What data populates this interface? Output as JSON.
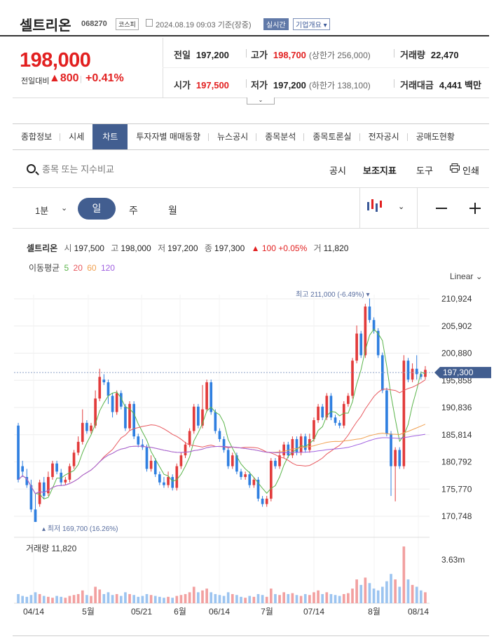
{
  "header": {
    "name": "셀트리온",
    "code": "068270",
    "market": "코스피",
    "date": "2024.08.19 09:03 기준(장중)",
    "realtime": "실시간",
    "company_info": "기업개요 ▾"
  },
  "quote": {
    "price": "198,000",
    "diff_label": "전일대비",
    "diff_value": "▲800",
    "diff_pct": "+0.41%",
    "prev_label": "전일",
    "prev": "197,200",
    "high_label": "고가",
    "high": "198,700",
    "upper_limit": "(상한가 256,000)",
    "volume_label": "거래량",
    "volume": "22,470",
    "open_label": "시가",
    "open": "197,500",
    "low_label": "저가",
    "low": "197,200",
    "lower_limit": "(하한가 138,100)",
    "amount_label": "거래대금",
    "amount": "4,441 백만"
  },
  "tabs": [
    "종합정보",
    "시세",
    "차트",
    "투자자별 매매동향",
    "뉴스공시",
    "종목분석",
    "종목토론실",
    "전자공시",
    "공매도현황"
  ],
  "search": {
    "placeholder": "종목 또는 지수비교",
    "tools": [
      "공시",
      "보조지표",
      "도구",
      "인쇄"
    ]
  },
  "period": {
    "interval": "1분",
    "day": "일",
    "week": "주",
    "month": "월"
  },
  "chart_info": {
    "name": "셀트리온",
    "open_k": "시",
    "open": "197,500",
    "high_k": "고",
    "high": "198,000",
    "low_k": "저",
    "low": "197,200",
    "close_k": "종",
    "close": "197,300",
    "change": "▲ 100 +0.05%",
    "vol_k": "거",
    "vol": "11,820",
    "ma_label": "이동평균",
    "ma": [
      {
        "period": "5",
        "color": "#5ab44a"
      },
      {
        "period": "20",
        "color": "#e8585e"
      },
      {
        "period": "60",
        "color": "#f0a050"
      },
      {
        "period": "120",
        "color": "#a060e0"
      }
    ],
    "scale": "Linear"
  },
  "chart_data": {
    "type": "candlestick",
    "y_ticks": [
      "210,924",
      "205,902",
      "200,880",
      "195,858",
      "190,836",
      "185,814",
      "180,792",
      "175,770",
      "170,748"
    ],
    "y_range": [
      168500,
      213500
    ],
    "x_ticks": [
      "04/14",
      "5월",
      "05/21",
      "6월",
      "06/14",
      "7월",
      "07/14",
      "8월",
      "08/14"
    ],
    "current_price": "197,300",
    "current_value": 197300,
    "max_label": "최고 211,000 (-6.49%)",
    "max_value": 211000,
    "min_label": "최저 169,700 (16.26%)",
    "min_value": 169700,
    "volume_label": "거래량 11,820",
    "volume_scale": "3.63m",
    "candles": [
      [
        187500,
        177500,
        188000,
        177000
      ],
      [
        180000,
        179000,
        181000,
        178000
      ],
      [
        178000,
        176500,
        179500,
        176000
      ],
      [
        176500,
        172000,
        177500,
        171500
      ],
      [
        172000,
        169700,
        175000,
        169700
      ],
      [
        173000,
        177000,
        177500,
        172500
      ],
      [
        177000,
        174500,
        178000,
        174000
      ],
      [
        175000,
        178000,
        179000,
        174500
      ],
      [
        178000,
        180500,
        181000,
        177500
      ],
      [
        180500,
        179000,
        181000,
        178500
      ],
      [
        178800,
        177000,
        179500,
        176500
      ],
      [
        177000,
        177500,
        178000,
        176500
      ],
      [
        177500,
        180000,
        180500,
        177000
      ],
      [
        180000,
        182500,
        183000,
        179500
      ],
      [
        182500,
        184500,
        185500,
        182000
      ],
      [
        184500,
        188000,
        190500,
        184000
      ],
      [
        188000,
        186500,
        188500,
        186000
      ],
      [
        186500,
        187500,
        188000,
        186000
      ],
      [
        187500,
        192500,
        194000,
        187000
      ],
      [
        192500,
        196500,
        198000,
        192000
      ],
      [
        196000,
        195500,
        197000,
        195000
      ],
      [
        195500,
        193000,
        196000,
        191500
      ],
      [
        193000,
        190000,
        193500,
        189000
      ],
      [
        190000,
        193500,
        194000,
        189500
      ],
      [
        193500,
        191000,
        194000,
        190500
      ],
      [
        191000,
        187000,
        191500,
        186500
      ],
      [
        187000,
        191500,
        192000,
        186500
      ],
      [
        191500,
        185500,
        192000,
        185000
      ],
      [
        185500,
        184000,
        186000,
        183500
      ],
      [
        184000,
        183500,
        185000,
        183000
      ],
      [
        183500,
        179500,
        184000,
        179000
      ],
      [
        179500,
        181000,
        182000,
        179000
      ],
      [
        181000,
        178500,
        181500,
        178000
      ],
      [
        178500,
        177000,
        179000,
        176500
      ],
      [
        177000,
        176500,
        178000,
        176000
      ],
      [
        176500,
        178000,
        179000,
        176000
      ],
      [
        178000,
        176000,
        178500,
        175500
      ],
      [
        176000,
        180000,
        180500,
        175500
      ],
      [
        180000,
        182000,
        182500,
        179500
      ],
      [
        182000,
        184000,
        184500,
        181500
      ],
      [
        184000,
        186500,
        187000,
        183500
      ],
      [
        186500,
        191000,
        191500,
        186000
      ],
      [
        191000,
        187500,
        191500,
        187000
      ],
      [
        187500,
        190500,
        195000,
        187000
      ],
      [
        190500,
        195500,
        196000,
        190000
      ],
      [
        195500,
        190000,
        196000,
        189500
      ],
      [
        190000,
        186500,
        190500,
        186000
      ],
      [
        186500,
        185000,
        187000,
        184500
      ],
      [
        185000,
        183000,
        185500,
        182500
      ],
      [
        183000,
        180000,
        183500,
        179500
      ],
      [
        180000,
        182000,
        182500,
        179500
      ],
      [
        182000,
        179000,
        182500,
        178500
      ],
      [
        179000,
        178000,
        179500,
        177500
      ],
      [
        178000,
        178500,
        179000,
        177500
      ],
      [
        178500,
        176500,
        179000,
        176000
      ],
      [
        176500,
        177500,
        178000,
        176000
      ],
      [
        177500,
        174000,
        178000,
        173500
      ],
      [
        174000,
        173000,
        174500,
        172500
      ],
      [
        173000,
        174000,
        174500,
        172500
      ],
      [
        174000,
        181000,
        181500,
        173500
      ],
      [
        181000,
        180000,
        181500,
        179500
      ],
      [
        180000,
        182000,
        183000,
        179500
      ],
      [
        182000,
        184000,
        184500,
        181500
      ],
      [
        184000,
        182000,
        184500,
        181500
      ],
      [
        182000,
        185000,
        185500,
        181500
      ],
      [
        185000,
        182500,
        185500,
        182000
      ],
      [
        182500,
        185500,
        186000,
        182000
      ],
      [
        185500,
        183000,
        186000,
        182500
      ],
      [
        183000,
        185000,
        186000,
        182500
      ],
      [
        185000,
        188500,
        189000,
        184500
      ],
      [
        188500,
        191000,
        191500,
        188000
      ],
      [
        191000,
        189000,
        191500,
        188500
      ],
      [
        189000,
        193000,
        193500,
        188500
      ],
      [
        193000,
        189000,
        193500,
        188500
      ],
      [
        189000,
        188000,
        189500,
        187500
      ],
      [
        188000,
        187500,
        188500,
        187000
      ],
      [
        187500,
        191500,
        192000,
        187000
      ],
      [
        191500,
        193000,
        193500,
        191000
      ],
      [
        193000,
        199500,
        200000,
        192500
      ],
      [
        199500,
        204500,
        206000,
        199000
      ],
      [
        204500,
        200500,
        205000,
        200000
      ],
      [
        200500,
        209500,
        210000,
        200000
      ],
      [
        209500,
        207000,
        211000,
        206500
      ],
      [
        207000,
        205000,
        207500,
        204500
      ],
      [
        205000,
        200500,
        205500,
        200000
      ],
      [
        200500,
        194000,
        201000,
        193500
      ],
      [
        194000,
        186000,
        194500,
        185500
      ],
      [
        186000,
        180000,
        186500,
        174500
      ],
      [
        180000,
        183000,
        183500,
        173500
      ],
      [
        183000,
        180000,
        183500,
        179500
      ],
      [
        180000,
        199500,
        200500,
        179500
      ],
      [
        199500,
        196000,
        200000,
        195500
      ],
      [
        196000,
        198000,
        199000,
        195500
      ],
      [
        198000,
        197000,
        200500,
        196000
      ],
      [
        197000,
        196500,
        197500,
        196000
      ],
      [
        196500,
        197800,
        198500,
        196000
      ]
    ],
    "volumes": [
      0.1,
      0.08,
      0.07,
      0.09,
      0.12,
      0.1,
      0.08,
      0.07,
      0.06,
      0.08,
      0.07,
      0.06,
      0.08,
      0.09,
      0.1,
      0.14,
      0.09,
      0.08,
      0.18,
      0.15,
      0.1,
      0.12,
      0.09,
      0.1,
      0.08,
      0.12,
      0.1,
      0.09,
      0.07,
      0.08,
      0.1,
      0.09,
      0.08,
      0.07,
      0.06,
      0.07,
      0.06,
      0.08,
      0.09,
      0.1,
      0.12,
      0.18,
      0.12,
      0.14,
      0.16,
      0.12,
      0.1,
      0.09,
      0.08,
      0.12,
      0.1,
      0.09,
      0.07,
      0.06,
      0.08,
      0.07,
      0.1,
      0.09,
      0.07,
      0.16,
      0.1,
      0.09,
      0.12,
      0.1,
      0.11,
      0.09,
      0.08,
      0.1,
      0.09,
      0.12,
      0.14,
      0.1,
      0.12,
      0.1,
      0.09,
      0.08,
      0.1,
      0.11,
      0.16,
      0.26,
      0.2,
      0.28,
      0.22,
      0.16,
      0.14,
      0.18,
      0.24,
      0.32,
      0.26,
      0.18,
      0.62,
      0.26,
      0.2,
      0.18,
      0.14,
      0.12
    ]
  }
}
